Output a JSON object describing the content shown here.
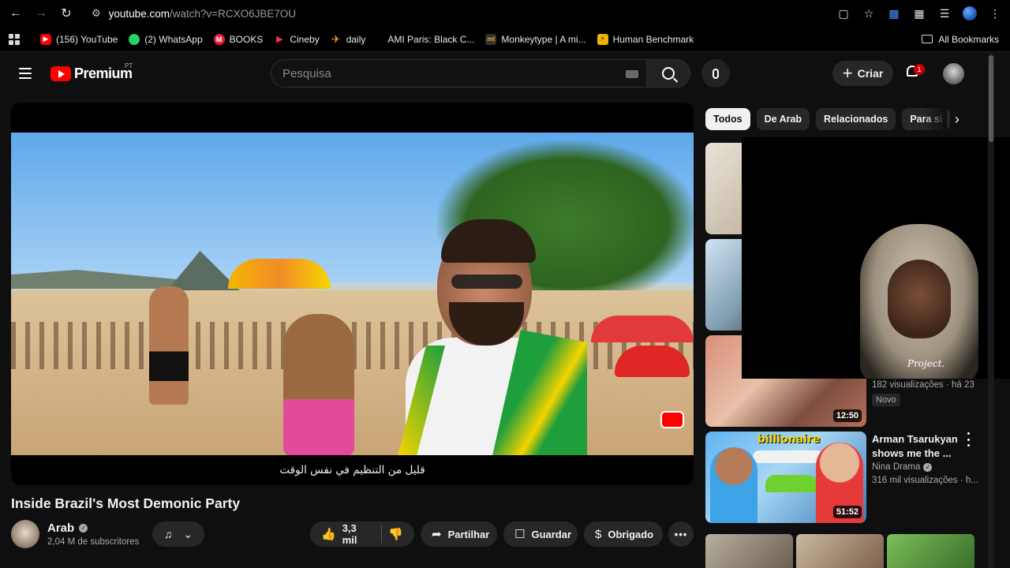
{
  "browser": {
    "url_host": "youtube.com",
    "url_path": "/watch?v=RCXO6JBE7OU"
  },
  "bookmarks": [
    {
      "label": "(156) YouTube",
      "icon": "youtube-icon"
    },
    {
      "label": "(2) WhatsApp",
      "icon": "whatsapp-icon"
    },
    {
      "label": "BOOKS",
      "icon": "books-icon"
    },
    {
      "label": "Cineby",
      "icon": "cineby-icon"
    },
    {
      "label": "daily",
      "icon": "daily-icon"
    },
    {
      "label": "AMI Paris: Black C...",
      "icon": "ami-icon"
    },
    {
      "label": "Monkeytype | A mi...",
      "icon": "monkeytype-icon"
    },
    {
      "label": "Human Benchmark",
      "icon": "human-benchmark-icon"
    }
  ],
  "all_bookmarks_label": "All Bookmarks",
  "youtube": {
    "logo_text": "Premium",
    "country_code": "PT",
    "search_placeholder": "Pesquisa",
    "create_label": "Criar",
    "notification_count": "1"
  },
  "video": {
    "caption": "قليل من التنظيم في نفس الوقت",
    "title": "Inside Brazil's Most Demonic Party",
    "channel": "Arab",
    "subscribers": "2,04 M de subscritores",
    "likes": "3,3 mil",
    "share_label": "Partilhar",
    "save_label": "Guardar",
    "thanks_label": "Obrigado"
  },
  "chips": [
    "Todos",
    "De Arab",
    "Relacionados",
    "Para si"
  ],
  "recommendations": [
    {
      "duration": "",
      "meta": ""
    },
    {
      "duration": "",
      "meta": ""
    },
    {
      "duration": "12:50",
      "views": "182 visualizações · há 23",
      "badge": "Novo"
    },
    {
      "duration": "51:52",
      "title": "Arman Tsarukyan shows me the ...",
      "channel": "Nina Drama",
      "views": "316 mil visualizações · h...",
      "thumb_text": "billionaire"
    }
  ],
  "pip": {
    "shirt_text": "Project."
  },
  "colors": {
    "accent": "#ff0000",
    "background": "#0f0f0f",
    "chip_active": "#f1f1f1"
  }
}
